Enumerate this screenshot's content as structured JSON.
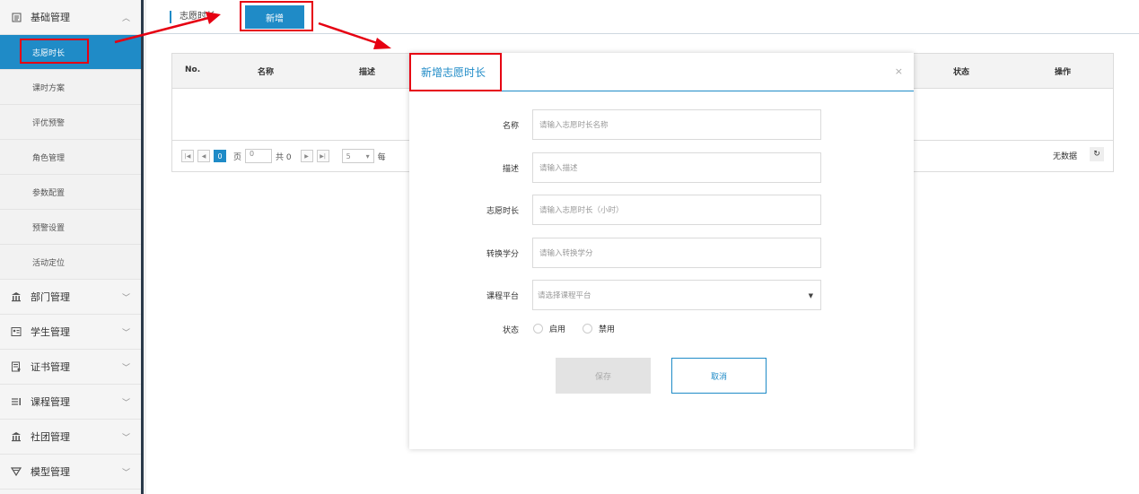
{
  "sidebar": {
    "groups": [
      {
        "label": "基础管理",
        "icon": "document-icon",
        "expanded": true,
        "items": [
          "志愿时长",
          "课时方案",
          "评优预警",
          "角色管理",
          "参数配置",
          "预警设置",
          "活动定位"
        ],
        "active_item": "志愿时长"
      },
      {
        "label": "部门管理",
        "icon": "institution-icon"
      },
      {
        "label": "学生管理",
        "icon": "student-card-icon"
      },
      {
        "label": "证书管理",
        "icon": "certificate-icon"
      },
      {
        "label": "课程管理",
        "icon": "list-icon"
      },
      {
        "label": "社团管理",
        "icon": "institution-icon"
      },
      {
        "label": "模型管理",
        "icon": "funnel-icon"
      }
    ]
  },
  "topbar": {
    "breadcrumb": "志愿时长",
    "add_button": "新增"
  },
  "table": {
    "columns": [
      "No.",
      "名称",
      "描述",
      "状态",
      "操作"
    ],
    "pager": {
      "current_page": "0",
      "page_label": "页",
      "page_input": "0",
      "total_label": "共 0",
      "page_size": "5",
      "per_page_label": "每",
      "no_data": "无数据"
    }
  },
  "modal": {
    "title": "新增志愿时长",
    "fields": [
      {
        "label": "名称",
        "placeholder": "请输入志愿时长名称"
      },
      {
        "label": "描述",
        "placeholder": "请输入描述"
      },
      {
        "label": "志愿时长",
        "placeholder": "请输入志愿时长（小时）"
      },
      {
        "label": "转换学分",
        "placeholder": "请输入转换学分"
      }
    ],
    "platform": {
      "label": "课程平台",
      "placeholder": "请选择课程平台"
    },
    "status": {
      "label": "状态",
      "options": [
        "启用",
        "禁用"
      ]
    },
    "save_button": "保存",
    "cancel_button": "取消"
  },
  "colors": {
    "accent": "#1f8bc7",
    "highlight": "#e60012",
    "sidebar_border": "#2b3a4a"
  }
}
